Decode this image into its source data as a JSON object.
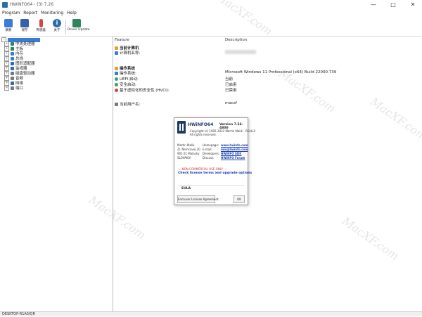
{
  "window": {
    "title": "HWiNFO64 - (3) 7.26",
    "minimize": "—",
    "maximize": "□",
    "close": "✕"
  },
  "menu": [
    "Program",
    "Report",
    "Monitoring",
    "Help"
  ],
  "toolbar": [
    {
      "label": "摘要",
      "icon": "monitor-icon",
      "color": "#3a7bd5"
    },
    {
      "label": "保存",
      "icon": "save-icon",
      "color": "#3a5fa8"
    },
    {
      "label": "传感器",
      "icon": "thermometer-icon",
      "color": "#d64541"
    },
    {
      "label": "关于",
      "icon": "info-icon",
      "color": "#2b6cb0"
    },
    {
      "label": "Driver Update",
      "icon": "driver-update-icon",
      "color": "#2f855a"
    }
  ],
  "tree": {
    "items": [
      {
        "label": "中央处理器",
        "color": "#2f855a"
      },
      {
        "label": "主板",
        "color": "#2f855a"
      },
      {
        "label": "内存",
        "color": "#3a7bd5"
      },
      {
        "label": "总线",
        "color": "#3a7bd5"
      },
      {
        "label": "图形适配器",
        "color": "#2b6cb0"
      },
      {
        "label": "监视器",
        "color": "#2b6cb0"
      },
      {
        "label": "磁盘驱动器",
        "color": "#777777"
      },
      {
        "label": "音频",
        "color": "#777777"
      },
      {
        "label": "网络",
        "color": "#2b6cb0"
      },
      {
        "label": "端口",
        "color": "#777777"
      }
    ]
  },
  "details": {
    "header_feature": "Feature",
    "header_description": "Description",
    "section_current_computer": "当前计算机",
    "computer_name_label": "计算机名称:",
    "section_os": "操作系统",
    "os_label": "操作系统:",
    "os_value": "Microsoft Windows 11 Professional (x64) Build 22000.739",
    "uefi_label": "UEFI 启动:",
    "uefi_value": "当前",
    "secure_boot_label": "安全启动:",
    "secure_boot_value": "已启用",
    "vbs_label": "基于虚拟化的安全性 (HVCI):",
    "vbs_value": "已禁用",
    "user_label": "当前用户名:",
    "user_value": "macxf"
  },
  "about_dialog": {
    "product": "HWiNFO64",
    "version": "Version 7.26-4800",
    "copyright": "Copyright (c) 1995-2022 Martin Malik - REALiX",
    "rights": "All rights reserved.",
    "address": [
      "Martin Malik",
      "Zl. Nemcovej 20",
      "901 01 Malacky",
      "SLOVAKIA"
    ],
    "contact_labels": [
      "Homepage:",
      "E-mail:",
      "Developers:",
      "Discuss:"
    ],
    "contact_values": [
      "www.hwinfo.com",
      "mm@hwinfo.com",
      "HWiNFO SDK",
      "HWiNFO Forum"
    ],
    "noncommercial": "--- NON-COMMERCIAL USE ONLY ---",
    "license_link": "Check license terms and upgrade options",
    "eula_title": "EULA",
    "eula_button": "End-user License Agreement",
    "ok_button": "OK"
  },
  "statusbar": "DESKTOP-R1A5IQR",
  "watermark": "MacXF.com"
}
